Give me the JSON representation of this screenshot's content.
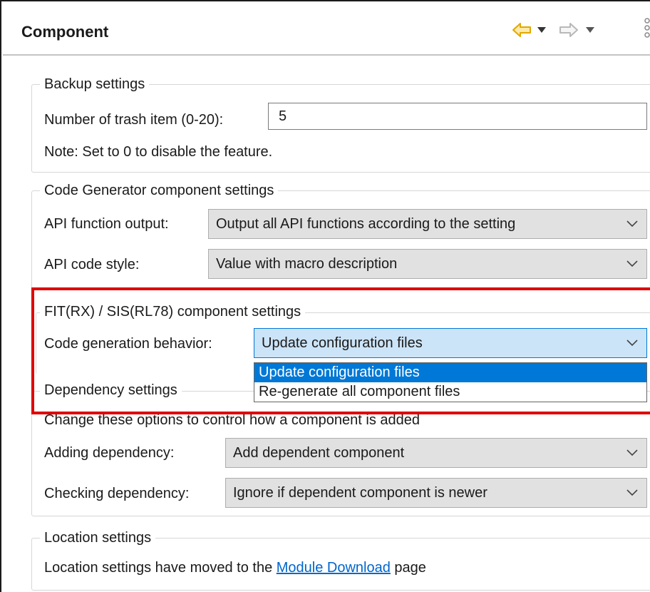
{
  "header": {
    "title": "Component",
    "icons": [
      "back-arrow-icon",
      "chevron-down-icon",
      "forward-arrow-icon",
      "chevron-down-icon",
      "more-icon"
    ],
    "accent": "#f0b400"
  },
  "backup": {
    "legend": "Backup settings",
    "trash_label": "Number of trash item (0-20):",
    "trash_value": "5",
    "note": "Note: Set to 0 to disable the feature."
  },
  "codegen": {
    "legend": "Code Generator component settings",
    "api_output_label": "API function output:",
    "api_output_value": "Output all API functions according to the setting",
    "api_style_label": "API code style:",
    "api_style_value": "Value with macro description"
  },
  "fit": {
    "legend": "FIT(RX) / SIS(RL78) component settings",
    "behavior_label": "Code generation behavior:",
    "behavior_value": "Update configuration files",
    "options": [
      "Update configuration files",
      "Re-generate all component files"
    ],
    "highlight_color": "#e00000"
  },
  "dependency": {
    "legend": "Dependency settings",
    "note": "Change these options to control how a component is added",
    "adding_label": "Adding dependency:",
    "adding_value": "Add dependent component",
    "checking_label": "Checking dependency:",
    "checking_value": "Ignore if dependent component is newer"
  },
  "location": {
    "legend": "Location settings",
    "text_before": "Location settings have moved to the ",
    "link": "Module Download",
    "text_after": " page"
  }
}
